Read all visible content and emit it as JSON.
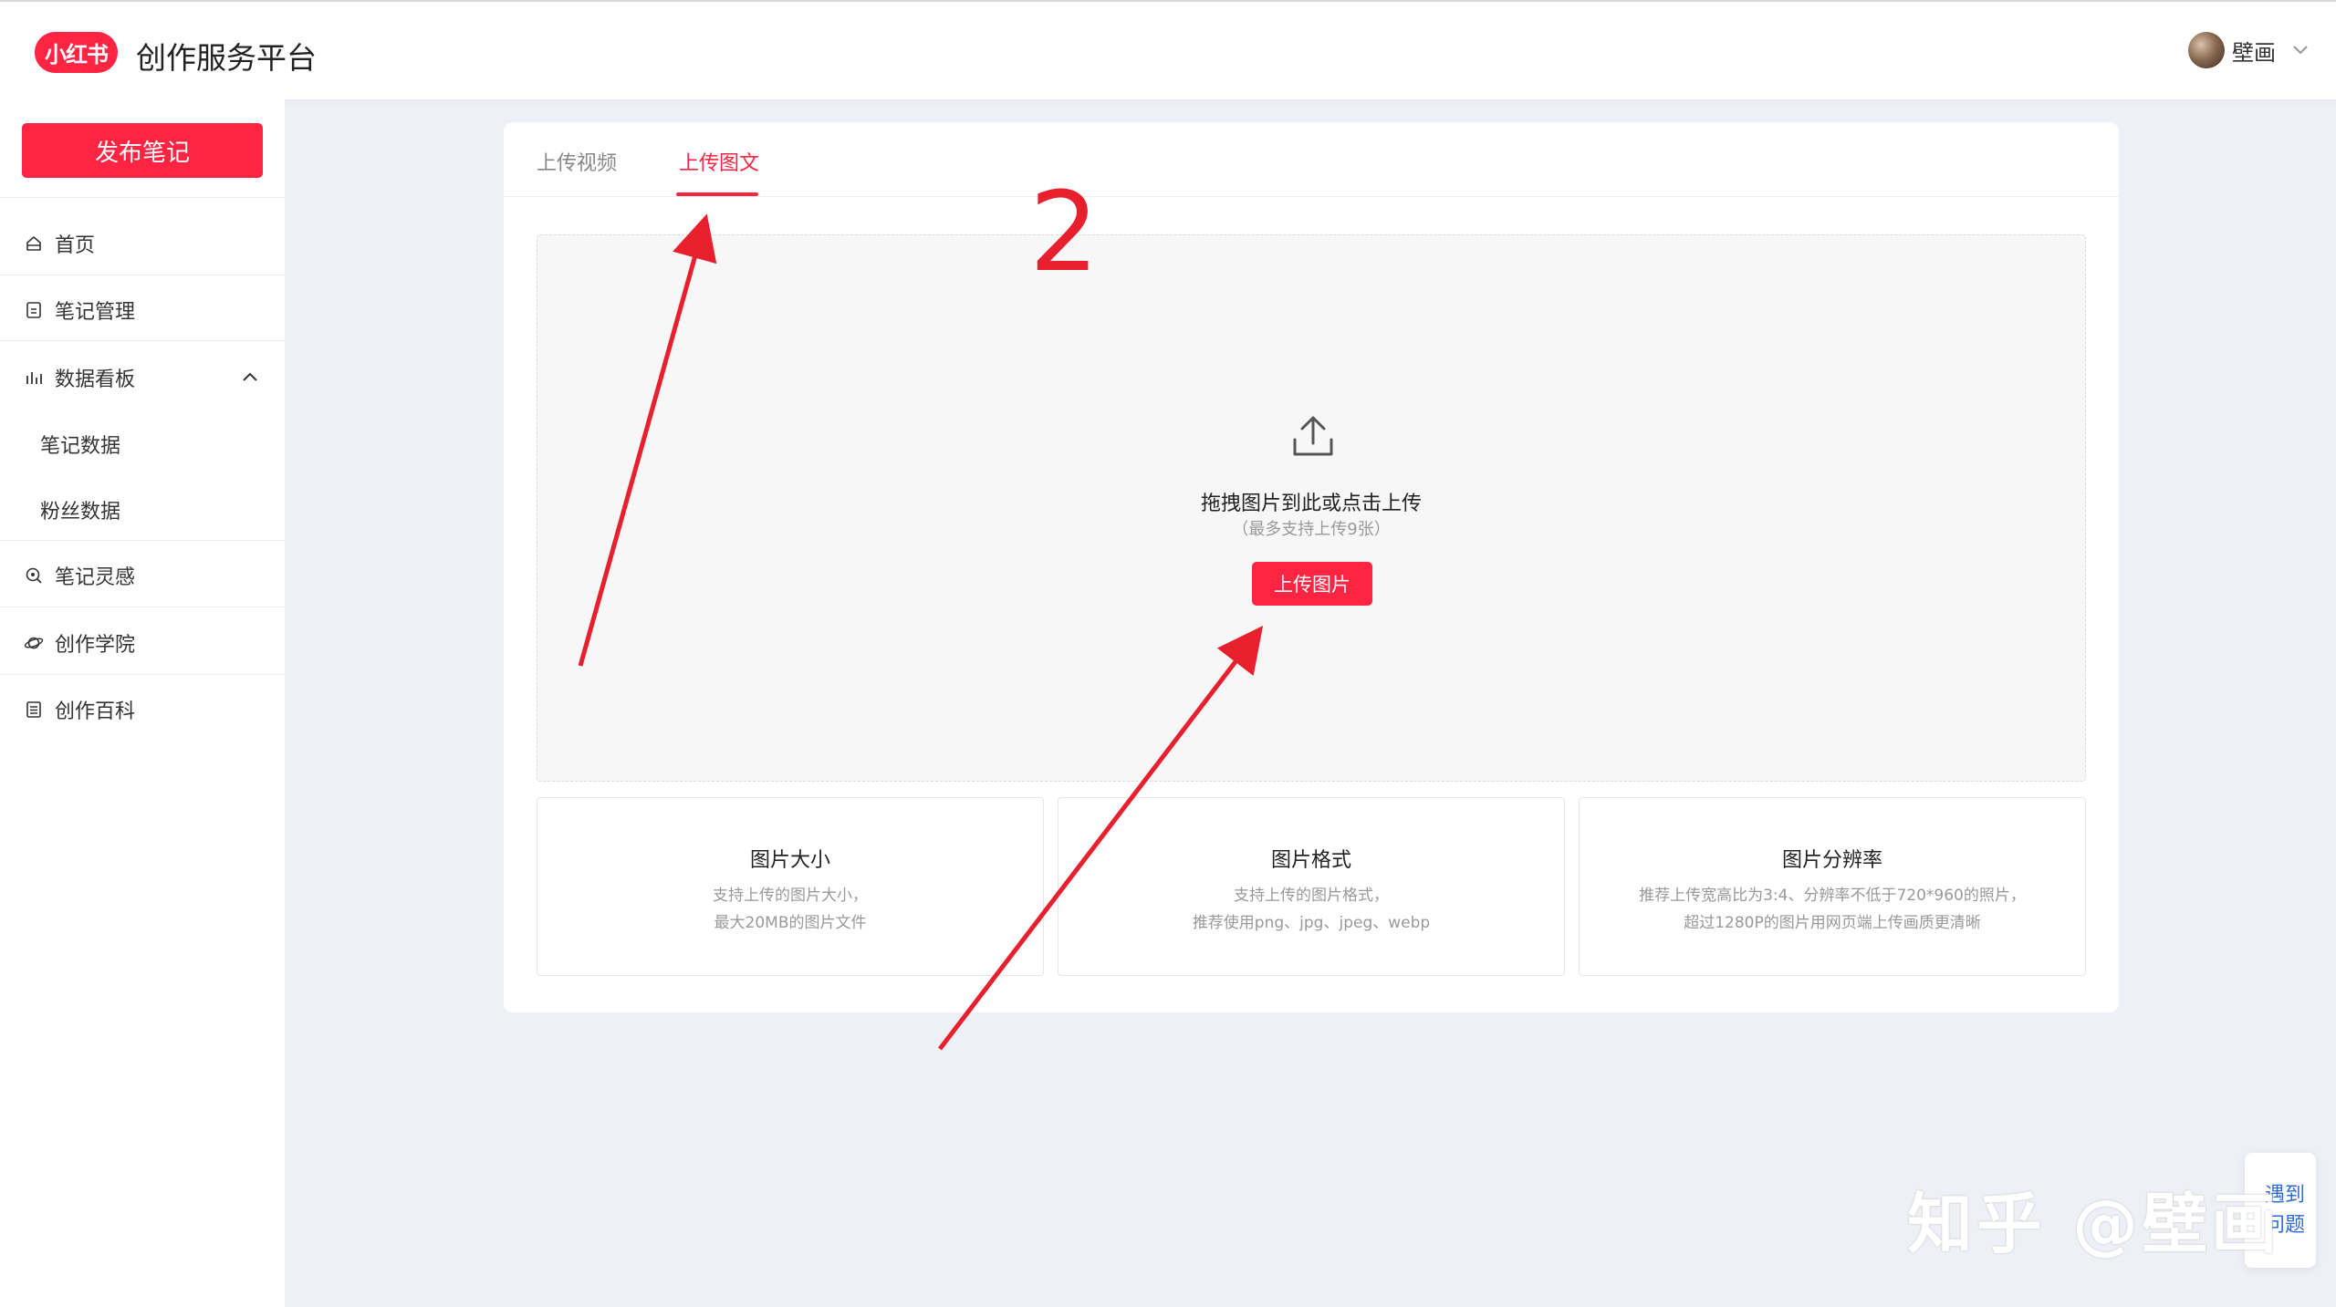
{
  "header": {
    "logo_text": "小红书",
    "title": "创作服务平台",
    "user_name": "壁画"
  },
  "sidebar": {
    "publish_label": "发布笔记",
    "items": [
      {
        "label": "首页",
        "icon": "home-icon"
      },
      {
        "label": "笔记管理",
        "icon": "note-icon"
      },
      {
        "label": "数据看板",
        "icon": "chart-icon",
        "expanded": true
      },
      {
        "label": "笔记数据"
      },
      {
        "label": "粉丝数据"
      },
      {
        "label": "笔记灵感",
        "icon": "inspiration-icon"
      },
      {
        "label": "创作学院",
        "icon": "planet-icon"
      },
      {
        "label": "创作百科",
        "icon": "book-icon"
      }
    ]
  },
  "main": {
    "tabs": [
      {
        "label": "上传视频",
        "active": false
      },
      {
        "label": "上传图文",
        "active": true
      }
    ],
    "dropzone": {
      "title": "拖拽图片到此或点击上传",
      "subtitle": "（最多支持上传9张）",
      "button_label": "上传图片"
    },
    "info_boxes": [
      {
        "title": "图片大小",
        "line1": "支持上传的图片大小，",
        "line2": "最大20MB的图片文件"
      },
      {
        "title": "图片格式",
        "line1": "支持上传的图片格式，",
        "line2": "推荐使用png、jpg、jpeg、webp"
      },
      {
        "title": "图片分辨率",
        "line1": "推荐上传宽高比为3:4、分辨率不低于720*960的照片，",
        "line2": "超过1280P的图片用网页端上传画质更清晰"
      }
    ]
  },
  "annotation": {
    "step_number": "2",
    "color": "#e8202e"
  },
  "watermark": "知乎 @壁画",
  "help": {
    "label": "遇到问题"
  },
  "colors": {
    "accent": "#ff2442",
    "background": "#eef0f7",
    "link": "#2f6bd8"
  }
}
